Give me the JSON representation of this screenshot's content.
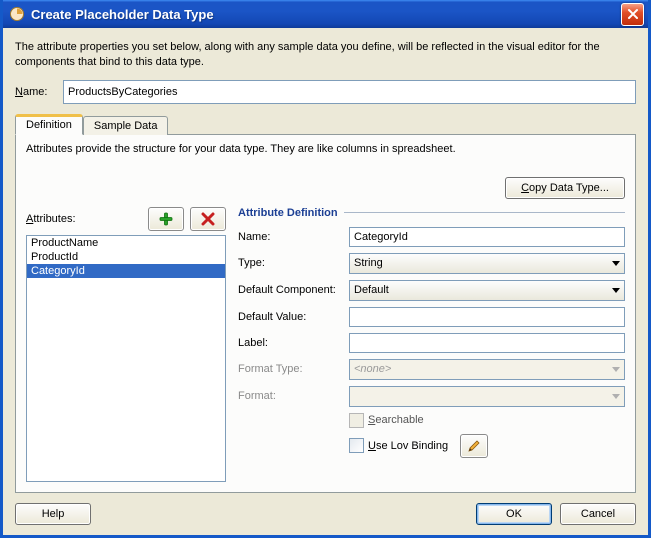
{
  "window": {
    "title": "Create Placeholder Data Type",
    "icon": "orb-icon"
  },
  "intro": "The attribute properties you set below, along with any sample data you define, will be reflected in the visual editor for the components that bind to this data type.",
  "name_row": {
    "label_prefix": "N",
    "label_rest": "ame:",
    "value": "ProductsByCategories"
  },
  "tabs": {
    "definition": "Definition",
    "sample": "Sample Data",
    "desc": "Attributes provide the structure for your data type. They are like columns in spreadsheet.",
    "copy_label": "Copy Data Type..."
  },
  "attributes": {
    "heading_prefix": "A",
    "heading_rest": "ttributes:",
    "items": [
      "ProductName",
      "ProductId",
      "CategoryId"
    ],
    "selected_index": 2
  },
  "defn": {
    "section": "Attribute Definition",
    "labels": {
      "name": "Name:",
      "type": "Type:",
      "default_component": "Default Component:",
      "default_value": "Default Value:",
      "label": "Label:",
      "format_type": "Format Type:",
      "format": "Format:",
      "searchable_prefix": "S",
      "searchable_rest": "earchable",
      "lov_prefix": "U",
      "lov_rest": "se Lov Binding"
    },
    "values": {
      "name": "CategoryId",
      "type": "String",
      "default_component": "Default",
      "default_value": "",
      "label": "",
      "format_type": "<none>",
      "format": ""
    }
  },
  "footer": {
    "help": "Help",
    "ok": "OK",
    "cancel": "Cancel"
  }
}
